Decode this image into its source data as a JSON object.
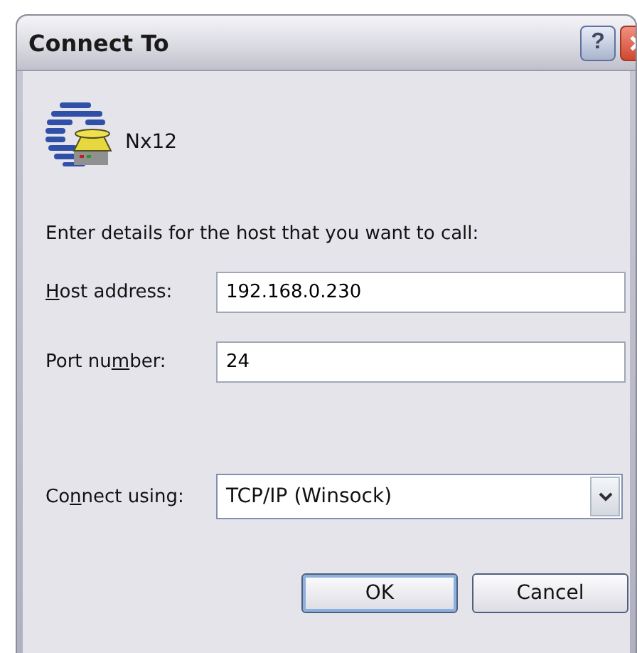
{
  "window": {
    "title": "Connect To",
    "title_buttons": [
      {
        "kind": "help",
        "label": "?"
      },
      {
        "kind": "close"
      }
    ]
  },
  "connection": {
    "name": "Nx12"
  },
  "prompt": "Enter details for the host that you want to call:",
  "fields": [
    {
      "label": {
        "key": "H",
        "after": "ost address:"
      },
      "value": "192.168.0.230"
    },
    {
      "label": {
        "before": "Port nu",
        "key": "m",
        "after": "ber:"
      },
      "value": "24"
    }
  ],
  "connect_using": {
    "label": {
      "before": "Co",
      "key": "n",
      "after": "nect using:"
    },
    "value": "TCP/IP (Winsock)"
  },
  "buttons": [
    {
      "label": "OK",
      "default": true
    },
    {
      "label": "Cancel",
      "default": false
    }
  ]
}
